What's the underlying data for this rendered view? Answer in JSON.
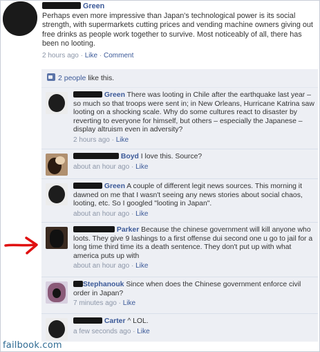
{
  "post": {
    "author_suffix": "Green",
    "text": "Perhaps even more impressive than Japan's technological power is its social strength, with supermarkets cutting prices and vending machine owners giving out free drinks as people work together to survive. Most noticeably of all, there has been no looting.",
    "time": "2 hours ago",
    "sep": "·",
    "like": "Like",
    "comment": "Comment"
  },
  "likes": {
    "count_link": "2 people",
    "suffix": " like this."
  },
  "comments": [
    {
      "author_suffix": "Green",
      "text": "There was looting in Chile after the earthquake last year – so much so that troops were sent in; in New Orleans, Hurricane Katrina saw looting on a shocking scale. Why do some cultures react to disaster by reverting to everyone for himself, but others – especially the Japanese – display altruism even in adversity?",
      "time": "2 hours ago",
      "like": "Like"
    },
    {
      "author_suffix": "Boyd",
      "text": "I love this. Source?",
      "time": "about an hour ago",
      "like": "Like"
    },
    {
      "author_suffix": "Green",
      "text": "A couple of different legit news sources. This morning it dawned on me that I wasn't seeing any news stories about social chaos, looting, etc. So I googled \"looting in Japan\".",
      "time": "about an hour ago",
      "like": "Like"
    },
    {
      "author_suffix": "Parker",
      "text": "Because the chinese government will kill anyone who loots. They give 9 lashings to a first offense dui second one u go to jail for a long time third time its a death sentence. They don't put up with what america puts up with",
      "time": "about an hour ago",
      "like": "Like"
    },
    {
      "author_suffix": "Stephanouk",
      "text": "Since when does the Chinese government enforce civil order in Japan?",
      "time": "7 minutes ago",
      "like": "Like"
    },
    {
      "author_suffix": "Carter",
      "text": "^ LOL.",
      "time": "a few seconds ago",
      "like": "Like"
    }
  ],
  "watermark": "failbook.com",
  "colors": {
    "link": "#3b5998",
    "comment_bg": "#edeff4",
    "arrow": "#e01010",
    "watermark": "#2f6b93"
  }
}
